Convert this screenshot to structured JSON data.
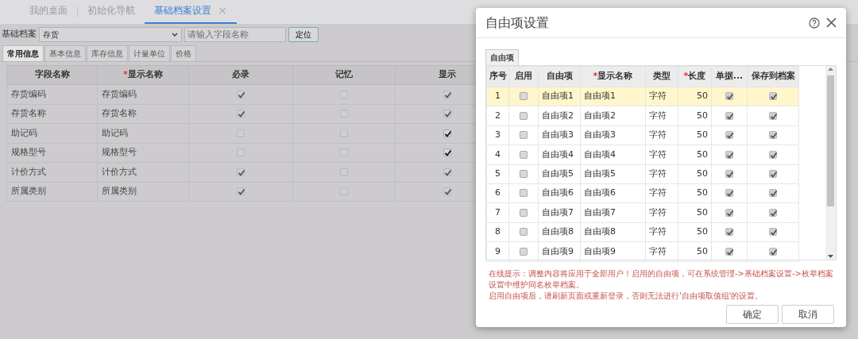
{
  "top_tabs": [
    {
      "label": "我的桌面",
      "selected": false,
      "closable": false
    },
    {
      "label": "初始化导航",
      "selected": false,
      "closable": false
    },
    {
      "label": "基础档案设置",
      "selected": true,
      "closable": true,
      "close_glyph": "×"
    }
  ],
  "filter": {
    "label": "基础档案",
    "select_value": "存货",
    "search_placeholder": "请输入字段名称",
    "locate_button": "定位"
  },
  "sub_tabs": [
    {
      "label": "常用信息",
      "selected": true
    },
    {
      "label": "基本信息",
      "selected": false
    },
    {
      "label": "库存信息",
      "selected": false
    },
    {
      "label": "计量单位",
      "selected": false
    },
    {
      "label": "价格",
      "selected": false
    }
  ],
  "fields_table": {
    "columns": [
      {
        "label": "字段名称"
      },
      {
        "label": "显示名称",
        "required_mark": "*"
      },
      {
        "label": "必录"
      },
      {
        "label": "记忆"
      },
      {
        "label": "显示"
      }
    ],
    "rows": [
      {
        "field": "存货编码",
        "display": "存货编码",
        "required": {
          "checked": true,
          "disabled": true
        },
        "remember": {
          "checked": false,
          "disabled": true
        },
        "show": {
          "checked": true,
          "disabled": true
        }
      },
      {
        "field": "存货名称",
        "display": "存货名称",
        "required": {
          "checked": true,
          "disabled": true
        },
        "remember": {
          "checked": false,
          "disabled": true
        },
        "show": {
          "checked": true,
          "disabled": true
        }
      },
      {
        "field": "助记码",
        "display": "助记码",
        "required": {
          "checked": false,
          "disabled": true
        },
        "remember": {
          "checked": false,
          "disabled": true
        },
        "show": {
          "checked": true,
          "disabled": false
        }
      },
      {
        "field": "规格型号",
        "display": "规格型号",
        "required": {
          "checked": false,
          "disabled": true
        },
        "remember": {
          "checked": false,
          "disabled": true
        },
        "show": {
          "checked": true,
          "disabled": false
        }
      },
      {
        "field": "计价方式",
        "display": "计价方式",
        "required": {
          "checked": true,
          "disabled": true
        },
        "remember": {
          "checked": false,
          "disabled": true
        },
        "show": {
          "checked": true,
          "disabled": true
        }
      },
      {
        "field": "所属类别",
        "display": "所属类别",
        "required": {
          "checked": true,
          "disabled": true
        },
        "remember": {
          "checked": false,
          "disabled": true
        },
        "show": {
          "checked": true,
          "disabled": true
        }
      }
    ]
  },
  "dialog": {
    "title": "自由项设置",
    "tabs": [
      {
        "label": "自由项",
        "selected": true
      }
    ],
    "columns": [
      {
        "label": "序号"
      },
      {
        "label": "启用"
      },
      {
        "label": "自由项"
      },
      {
        "label": "显示名称",
        "required_mark": "*"
      },
      {
        "label": "类型"
      },
      {
        "label": "长度",
        "required_mark": "*"
      },
      {
        "label": "单据..."
      },
      {
        "label": "保存到档案"
      }
    ],
    "rows": [
      {
        "seq": "1",
        "enabled": false,
        "item": "自由项1",
        "display": "自由项1",
        "type": "字符",
        "length": "50",
        "on_voucher": true,
        "save_to_archive": true,
        "selected": true
      },
      {
        "seq": "2",
        "enabled": false,
        "item": "自由项2",
        "display": "自由项2",
        "type": "字符",
        "length": "50",
        "on_voucher": true,
        "save_to_archive": true,
        "selected": false
      },
      {
        "seq": "3",
        "enabled": false,
        "item": "自由项3",
        "display": "自由项3",
        "type": "字符",
        "length": "50",
        "on_voucher": true,
        "save_to_archive": true,
        "selected": false
      },
      {
        "seq": "4",
        "enabled": false,
        "item": "自由项4",
        "display": "自由项4",
        "type": "字符",
        "length": "50",
        "on_voucher": true,
        "save_to_archive": true,
        "selected": false
      },
      {
        "seq": "5",
        "enabled": false,
        "item": "自由项5",
        "display": "自由项5",
        "type": "字符",
        "length": "50",
        "on_voucher": true,
        "save_to_archive": true,
        "selected": false
      },
      {
        "seq": "6",
        "enabled": false,
        "item": "自由项6",
        "display": "自由项6",
        "type": "字符",
        "length": "50",
        "on_voucher": true,
        "save_to_archive": true,
        "selected": false
      },
      {
        "seq": "7",
        "enabled": false,
        "item": "自由项7",
        "display": "自由项7",
        "type": "字符",
        "length": "50",
        "on_voucher": true,
        "save_to_archive": true,
        "selected": false
      },
      {
        "seq": "8",
        "enabled": false,
        "item": "自由项8",
        "display": "自由项8",
        "type": "字符",
        "length": "50",
        "on_voucher": true,
        "save_to_archive": true,
        "selected": false
      },
      {
        "seq": "9",
        "enabled": false,
        "item": "自由项9",
        "display": "自由项9",
        "type": "字符",
        "length": "50",
        "on_voucher": true,
        "save_to_archive": true,
        "selected": false
      }
    ],
    "hints": [
      "在线提示：调整内容将应用于全部用户！启用的自由项，可在系统管理->基础档案设置->枚举档案设置中维护同名枚举档案。",
      "启用自由项后，请刷新页面或重新登录，否则无法进行'自由项取值组'的设置。"
    ],
    "buttons": [
      {
        "label": "确定"
      },
      {
        "label": "取消"
      }
    ]
  }
}
